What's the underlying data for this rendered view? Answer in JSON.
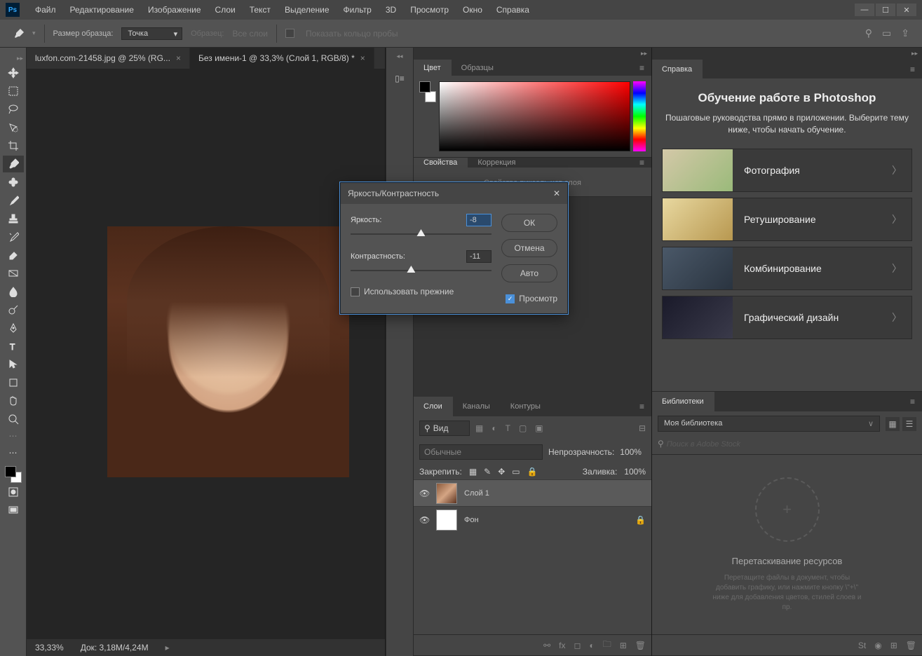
{
  "menu": {
    "items": [
      "Файл",
      "Редактирование",
      "Изображение",
      "Слои",
      "Текст",
      "Выделение",
      "Фильтр",
      "3D",
      "Просмотр",
      "Окно",
      "Справка"
    ]
  },
  "options": {
    "sample_label": "Размер образца:",
    "sample_value": "Точка",
    "sample2": "Образец:",
    "sample2_value": "Все слои",
    "show_ring": "Показать кольцо пробы"
  },
  "tabs": [
    {
      "label": "luxfon.com-21458.jpg @ 25% (RG...",
      "active": false
    },
    {
      "label": "Без имени-1 @ 33,3% (Слой 1, RGB/8) *",
      "active": true
    }
  ],
  "status": {
    "zoom": "33,33%",
    "doc": "Док: 3,18M/4,24M"
  },
  "panels": {
    "color": {
      "tab1": "Цвет",
      "tab2": "Образцы"
    },
    "props": {
      "tab1": "Свойства",
      "tab2": "Коррекция",
      "msg": "Свойства пиксель нет слоя"
    },
    "layers": {
      "tab1": "Слои",
      "tab2": "Каналы",
      "tab3": "Контуры",
      "search": "Вид",
      "mode": "Обычные",
      "opacity_l": "Непрозрачность:",
      "opacity_v": "100%",
      "lock_l": "Закрепить:",
      "fill_l": "Заливка:",
      "fill_v": "100%",
      "items": [
        {
          "name": "Слой 1"
        },
        {
          "name": "Фон"
        }
      ]
    },
    "help": {
      "tab": "Справка",
      "title": "Обучение работе в Photoshop",
      "sub": "Пошаговые руководства прямо в приложении. Выберите тему ниже, чтобы начать обучение.",
      "cards": [
        "Фотография",
        "Ретуширование",
        "Комбинирование",
        "Графический дизайн"
      ]
    },
    "lib": {
      "tab": "Библиотеки",
      "sel": "Моя библиотека",
      "search": "Поиск в Adobe Stock",
      "title": "Перетаскивание ресурсов",
      "msg": "Перетащите файлы в документ, чтобы добавить графику, или нажмите кнопку \\\"+\\\" ниже для добавления цветов, стилей слоев и пр."
    }
  },
  "dialog": {
    "title": "Яркость/Контрастность",
    "bright_l": "Яркость:",
    "bright_v": "-8",
    "contrast_l": "Контрастность:",
    "contrast_v": "-11",
    "legacy": "Использовать прежние",
    "ok": "ОК",
    "cancel": "Отмена",
    "auto": "Авто",
    "preview": "Просмотр"
  }
}
